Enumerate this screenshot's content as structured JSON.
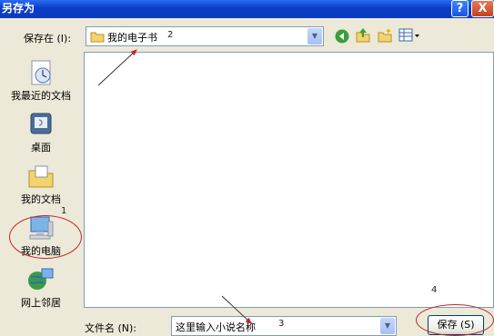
{
  "window": {
    "title": "另存为",
    "help_glyph": "?",
    "close_glyph": "X"
  },
  "toolbar": {
    "save_in_label": "保存在 (I):",
    "save_in_value": "我的电子书",
    "buttons": [
      "back-icon",
      "up-folder-icon",
      "new-folder-icon",
      "views-icon"
    ]
  },
  "places": [
    {
      "label": "我最近的文档",
      "icon": "recent-documents-icon"
    },
    {
      "label": "桌面",
      "icon": "desktop-icon"
    },
    {
      "label": "我的文档",
      "icon": "my-documents-icon"
    },
    {
      "label": "我的电脑",
      "icon": "my-computer-icon"
    },
    {
      "label": "网上邻居",
      "icon": "network-places-icon"
    }
  ],
  "filename": {
    "label": "文件名 (N):",
    "value": "这里输入小说名称"
  },
  "save_button": {
    "label": "保存 (S)"
  },
  "annotations": {
    "n1": "1",
    "n2": "2",
    "n3": "3",
    "n4": "4"
  },
  "colors": {
    "titlebar": "#0a3cc7",
    "dialog_bg": "#ece9d8",
    "annotation_red": "#c0242a"
  }
}
